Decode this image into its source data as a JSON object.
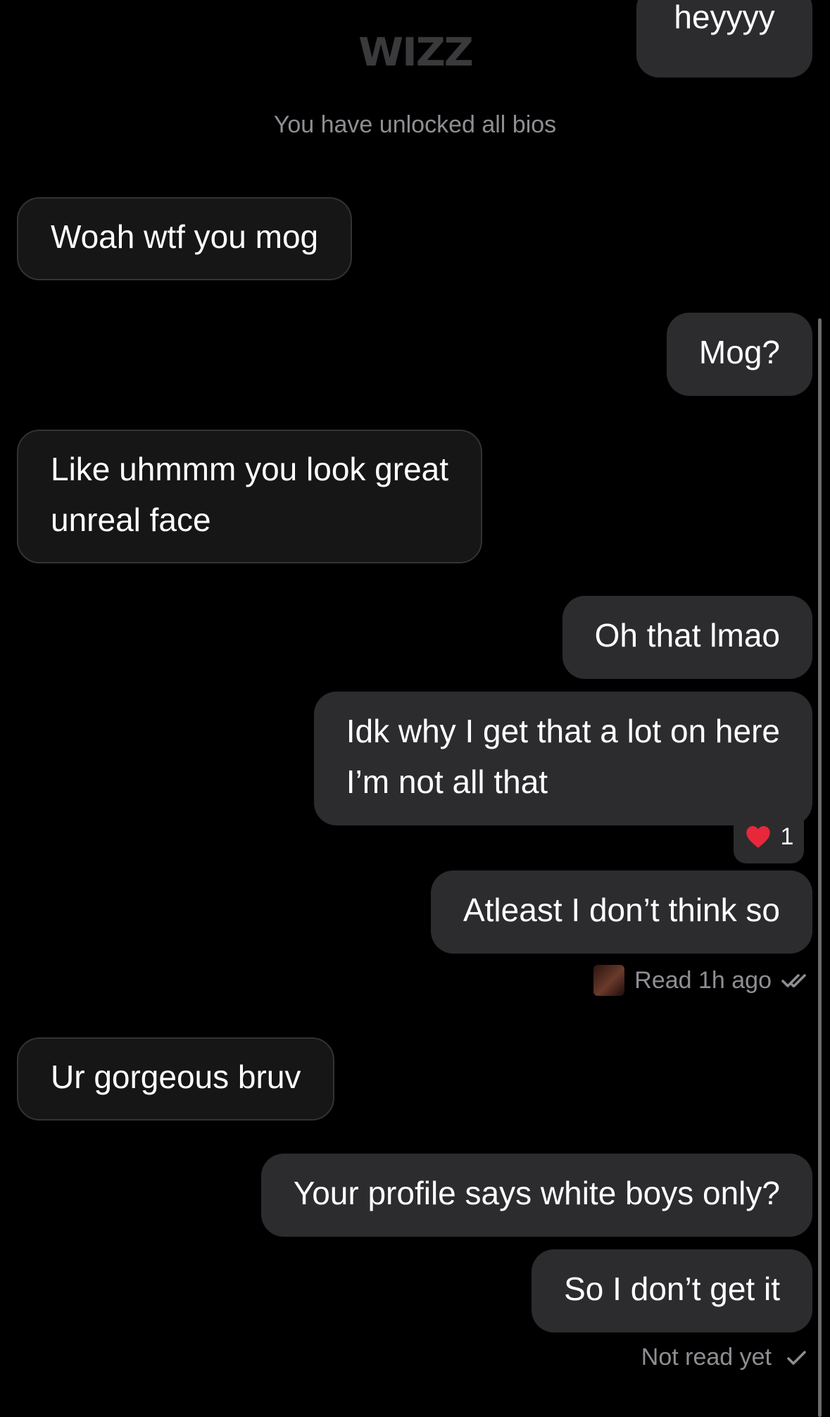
{
  "header": {
    "logo_text": "WIZZ"
  },
  "system_message": "You have unlocked all bios",
  "messages": [
    {
      "dir": "out",
      "text": "heyyyy"
    },
    {
      "dir": "in",
      "text": "Woah wtf you mog"
    },
    {
      "dir": "out",
      "text": "Mog?"
    },
    {
      "dir": "in",
      "line1": "Like uhmmm you look great",
      "line2": "unreal face"
    },
    {
      "dir": "out",
      "text": "Oh that lmao"
    },
    {
      "dir": "out",
      "line1": "Idk why I get that a lot on here",
      "line2": "I’m not all that"
    },
    {
      "dir": "out",
      "text": "Atleast I don’t think so"
    },
    {
      "dir": "in",
      "text": "Ur gorgeous bruv"
    },
    {
      "dir": "out",
      "text": "Your profile says white boys only?"
    },
    {
      "dir": "out",
      "text": "So I don’t get it"
    }
  ],
  "reaction": {
    "emoji_icon": "heart-icon",
    "count": "1"
  },
  "read_receipt": {
    "text": "Read 1h ago",
    "icon": "double-check-icon"
  },
  "delivery_status": {
    "text": "Not read yet",
    "icon": "check-icon"
  },
  "colors": {
    "background": "#000000",
    "incoming_bubble": "#161616",
    "outgoing_bubble": "#2c2c2e",
    "muted_text": "#8e8e93"
  }
}
